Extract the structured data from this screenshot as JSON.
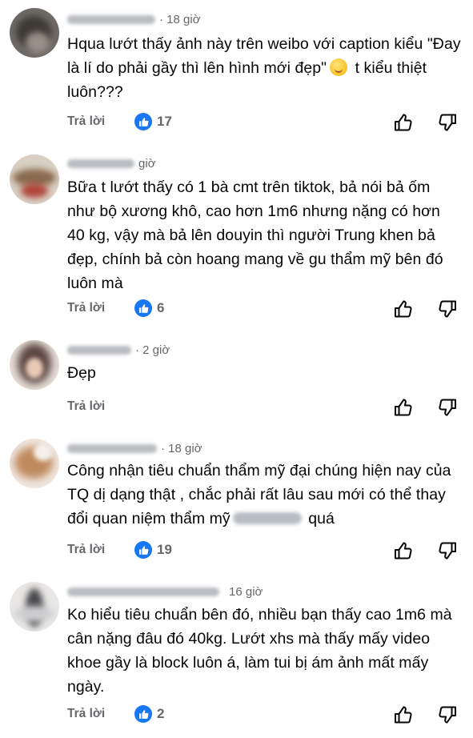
{
  "reply_label": "Trả lời",
  "colors": {
    "like_badge": "#1877f2",
    "meta_text": "#65676b",
    "body_text": "#050505"
  },
  "icons": {
    "like_badge": "thumbs-up-icon",
    "like": "thumbs-up-outline-icon",
    "dislike": "thumbs-down-outline-icon"
  },
  "comments": [
    {
      "time": "· 18 giờ",
      "text_before": "Hqua lướt thấy ảnh này trên weibo với caption kiểu \"Đay là lí do phải gầy thì lên hình mới đẹp\"",
      "text_after": " t kiểu thiệt luôn???",
      "likes": "17"
    },
    {
      "time": "giờ",
      "text": "Bữa t lướt thấy có 1 bà cmt trên tiktok, bả nói bả ốm như bộ xương khô, cao hơn 1m6 nhưng nặng có hơn 40 kg, vậy mà bả lên douyin thì người Trung khen bả đẹp, chính bả còn hoang mang về gu thẩm mỹ bên đó luôn mà",
      "likes": "6"
    },
    {
      "time": "· 2 giờ",
      "text": "Đẹp",
      "likes": ""
    },
    {
      "time": "· 18 giờ",
      "text_before": "Công nhận tiêu chuẩn thẩm mỹ đại chúng hiện nay của TQ dị dạng thật , chắc phải rất lâu sau mới có thể thay đổi quan niệm thẩm mỹ",
      "text_after": " quá",
      "likes": "19"
    },
    {
      "time": "16 giờ",
      "text": "Ko hiểu tiêu chuẩn bên đó, nhiều bạn thấy cao 1m6 mà cân nặng đâu đó 40kg. Lướt xhs mà thấy mấy video khoe gầy là block luôn á, làm tui bị ám ảnh mất mấy ngày.",
      "likes": "2"
    }
  ]
}
